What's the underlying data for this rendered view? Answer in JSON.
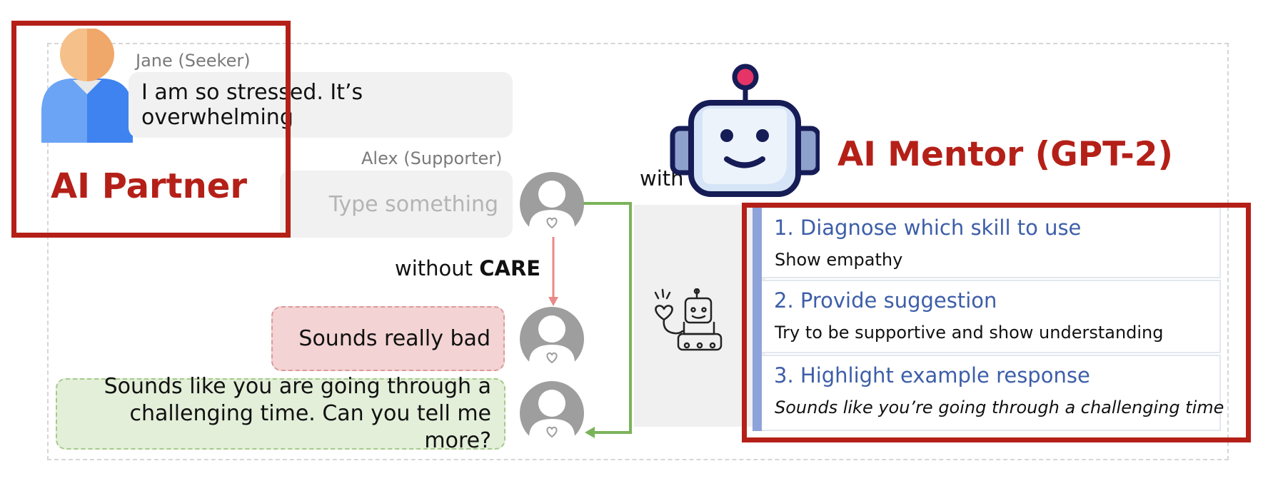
{
  "conversation": {
    "seeker_name": "Jane (Seeker)",
    "seeker_message": "I am so stressed. It’s overwhelming",
    "supporter_name": "Alex (Supporter)",
    "input_placeholder": "Type something",
    "without_prefix": "without ",
    "without_bold": "CARE",
    "with_label": "with",
    "response_without": "Sounds really bad",
    "response_with_line1": "Sounds like you are going through a",
    "response_with_line2": "challenging time. Can you tell me more?"
  },
  "callouts": {
    "partner_title": "AI Partner",
    "mentor_title": "AI Mentor (GPT-2)"
  },
  "steps": [
    {
      "title": "1. Diagnose which skill to use",
      "body": "Show empathy"
    },
    {
      "title": "2. Provide suggestion",
      "body": "Try to be supportive and show understanding"
    },
    {
      "title": "3. Highlight example response",
      "body": "Sounds like you’re going through a challenging time"
    }
  ],
  "colors": {
    "callout_red": "#b42018",
    "step_title_blue": "#3d5ea8",
    "arrow_red": "#e88a86",
    "arrow_green": "#7bb35a",
    "bad_fill": "#f3d3d3",
    "good_fill": "#e3efd9"
  },
  "icons": [
    "person-icon",
    "avatar-icon",
    "robot-icon",
    "robot-heart-icon",
    "arrow-icon"
  ]
}
